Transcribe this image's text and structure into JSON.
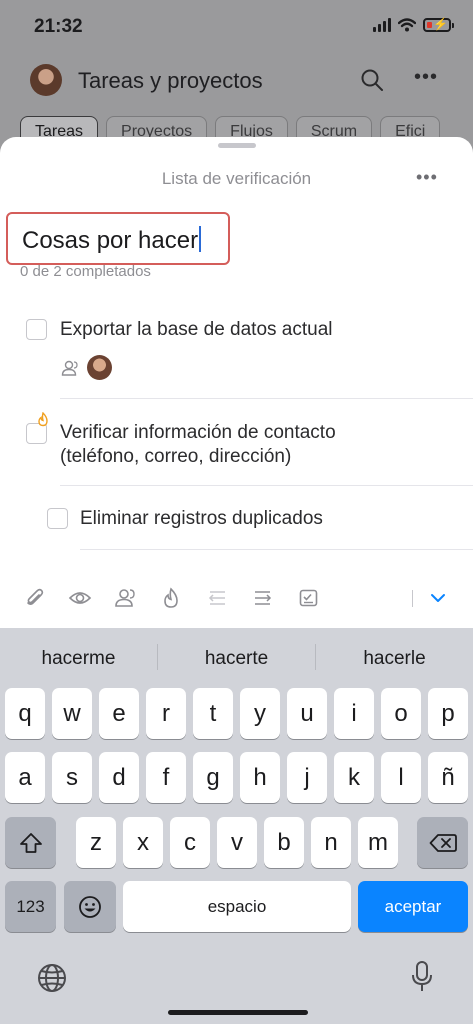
{
  "status_bar": {
    "time": "21:32",
    "icons": [
      "signal-icon",
      "wifi-icon",
      "battery-low-charging-icon"
    ],
    "battery_color": "#e0392c"
  },
  "app": {
    "title": "Tareas y proyectos",
    "tabs": [
      "Tareas",
      "Proyectos",
      "Flujos",
      "Scrum",
      "Efici"
    ]
  },
  "sheet": {
    "title": "Lista de verificación",
    "checklist_title": "Cosas por hacer",
    "progress": "0 de 2 completados",
    "items": [
      {
        "text": "Exportar la base de datos actual",
        "checked": false
      },
      {
        "text_line1": "Verificar información de contacto",
        "text_line2": "(teléfono, correo, dirección)",
        "checked": false
      },
      {
        "text": "Eliminar registros duplicados",
        "checked": false
      }
    ],
    "toolbar_icons": [
      "attach-icon",
      "eye-icon",
      "people-icon",
      "flame-icon",
      "outdent-icon",
      "indent-icon",
      "checklist-edit-icon",
      "chevron-down-icon"
    ]
  },
  "keyboard": {
    "suggestions": [
      "hacerme",
      "hacerte",
      "hacerle"
    ],
    "row1": [
      "q",
      "w",
      "e",
      "r",
      "t",
      "y",
      "u",
      "i",
      "o",
      "p"
    ],
    "row2": [
      "a",
      "s",
      "d",
      "f",
      "g",
      "h",
      "j",
      "k",
      "l",
      "ñ"
    ],
    "row3": [
      "z",
      "x",
      "c",
      "v",
      "b",
      "n",
      "m"
    ],
    "numbers_label": "123",
    "space_label": "espacio",
    "return_label": "aceptar",
    "accent_color": "#0a84ff"
  }
}
